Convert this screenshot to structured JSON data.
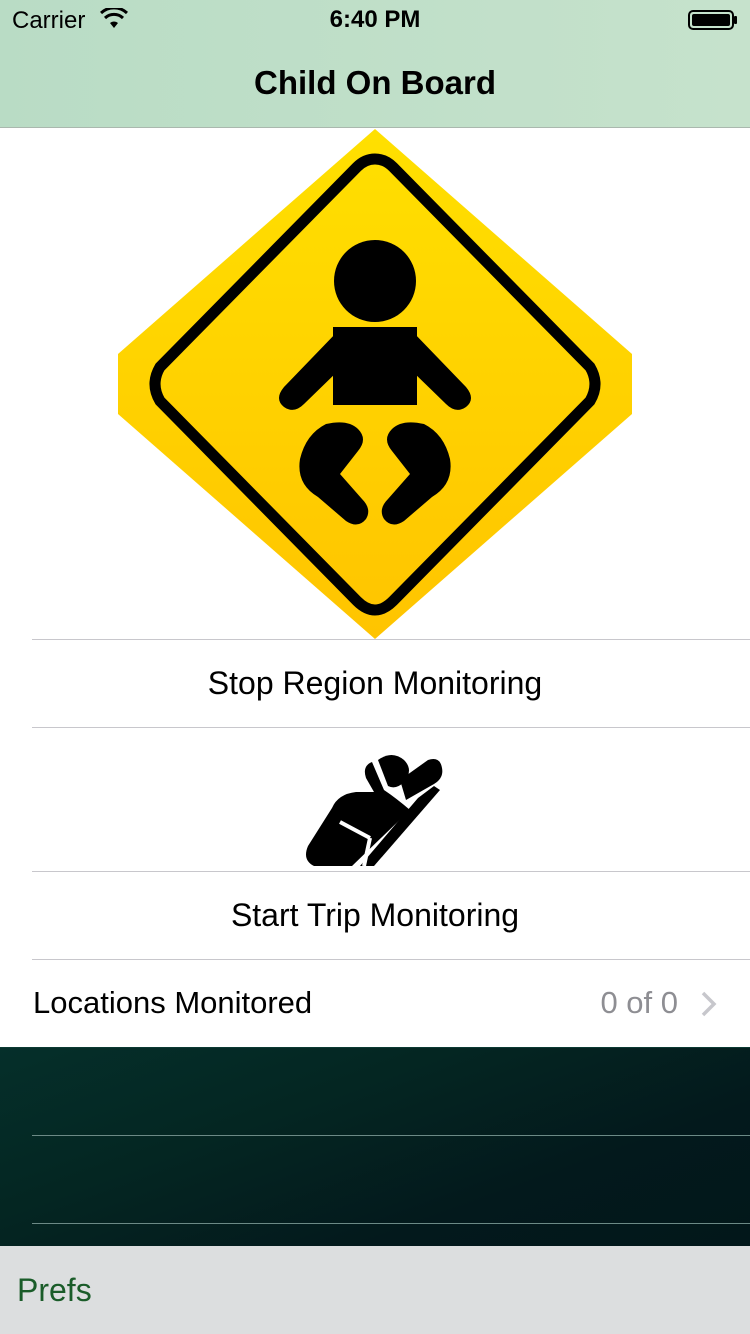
{
  "status_bar": {
    "carrier": "Carrier",
    "time": "6:40 PM"
  },
  "nav": {
    "title": "Child On Board"
  },
  "hero": {
    "icon": "baby-on-board-sign-icon",
    "sign_color": "#ffd200",
    "border_color": "#000000"
  },
  "rows": {
    "region_button": "Stop Region Monitoring",
    "car_seat_icon": "car-seat-icon",
    "trip_button": "Start Trip Monitoring",
    "locations_label": "Locations Monitored",
    "locations_value": "0 of 0"
  },
  "toolbar": {
    "prefs_label": "Prefs"
  },
  "colors": {
    "nav_tint": "#c6e2cc",
    "toolbar_text": "#1a5c29",
    "dark_bg": "#042622"
  }
}
